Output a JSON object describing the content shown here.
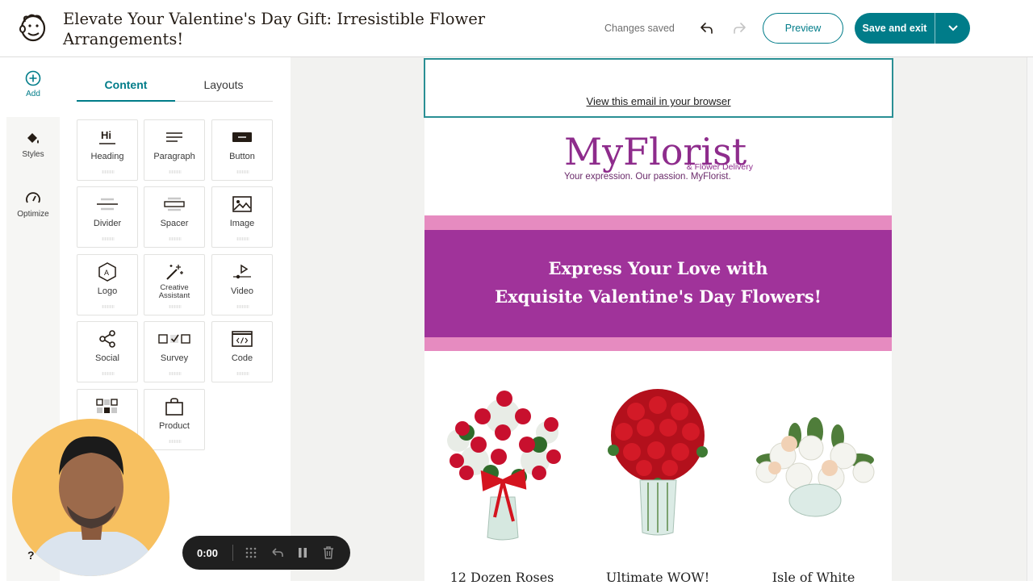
{
  "header": {
    "title": "Elevate Your Valentine's Day Gift: Irresistible Flower Arrangements!",
    "status": "Changes saved",
    "preview_label": "Preview",
    "save_label": "Save and exit"
  },
  "rail": {
    "add_label": "Add",
    "styles_label": "Styles",
    "optimize_label": "Optimize",
    "help_label": "?"
  },
  "panel": {
    "tabs": [
      "Content",
      "Layouts"
    ],
    "active_tab": "Content",
    "blocks": [
      {
        "label": "Heading",
        "icon": "heading-icon"
      },
      {
        "label": "Paragraph",
        "icon": "paragraph-icon"
      },
      {
        "label": "Button",
        "icon": "button-icon"
      },
      {
        "label": "Divider",
        "icon": "divider-icon"
      },
      {
        "label": "Spacer",
        "icon": "spacer-icon"
      },
      {
        "label": "Image",
        "icon": "image-icon"
      },
      {
        "label": "Logo",
        "icon": "logo-icon"
      },
      {
        "label": "Creative Assistant",
        "icon": "magic-wand-icon"
      },
      {
        "label": "Video",
        "icon": "video-icon"
      },
      {
        "label": "Social",
        "icon": "share-icon"
      },
      {
        "label": "Survey",
        "icon": "survey-icon"
      },
      {
        "label": "Code",
        "icon": "code-icon"
      },
      {
        "label": "",
        "icon": "apps-icon"
      },
      {
        "label": "Product",
        "icon": "bag-icon"
      }
    ]
  },
  "email": {
    "browser_link": "View this email in your browser",
    "brand": {
      "name": "MyFlorist",
      "sub": "& Flower Delivery",
      "tagline": "Your expression. Our passion. MyFlorist."
    },
    "banner": {
      "line1": "Express Your Love with",
      "line2": "Exquisite Valentine's Day Flowers!"
    },
    "products": [
      {
        "name": "12 Dozen Roses"
      },
      {
        "name": "Ultimate WOW!"
      },
      {
        "name": "Isle of White"
      }
    ]
  },
  "recorder": {
    "time": "0:00"
  },
  "colors": {
    "accent": "#007c89",
    "banner": "#a0339a",
    "banner_stripe": "#e68bc0",
    "brand_purple": "#8e2c8c"
  }
}
